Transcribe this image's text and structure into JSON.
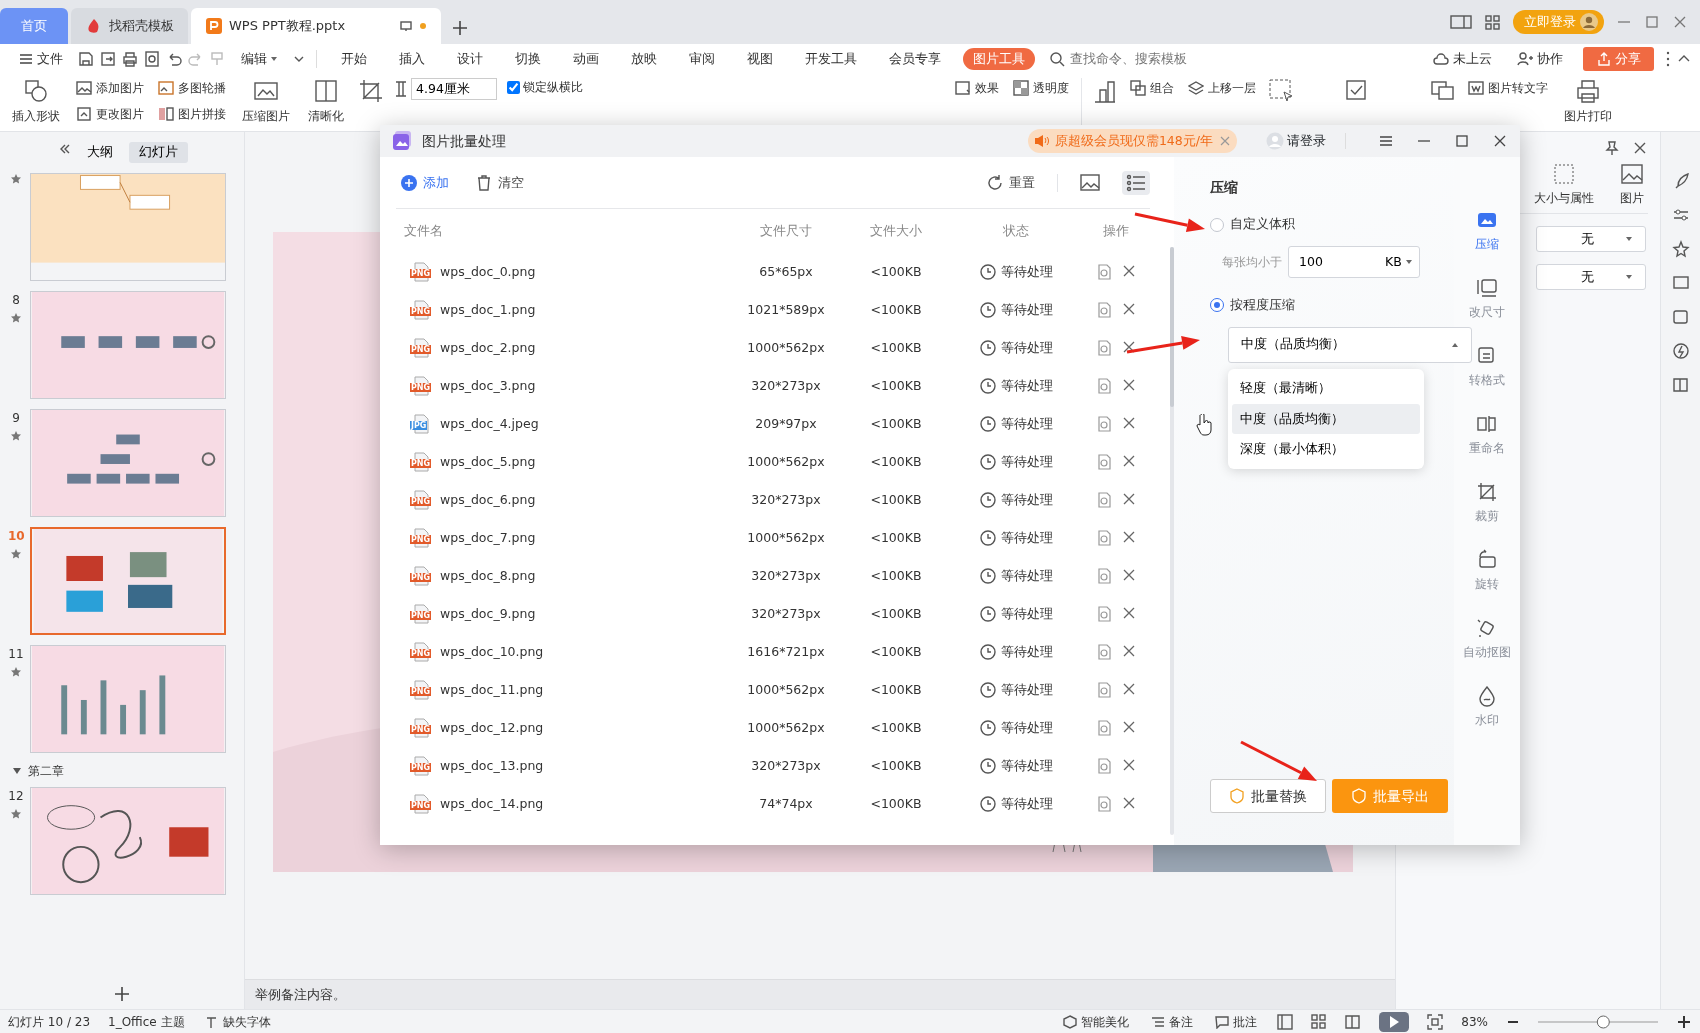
{
  "tabs": [
    {
      "label": "首页",
      "selected": false,
      "kind": "home"
    },
    {
      "label": "找稻壳模板",
      "selected": false,
      "kind": "docer"
    },
    {
      "label": "WPS PPT教程.pptx",
      "selected": true,
      "kind": "doc"
    }
  ],
  "title_bar": {
    "login": "立即登录"
  },
  "menu": {
    "file": "文件",
    "edit": "编辑",
    "items": [
      {
        "label": "开始",
        "selected": false
      },
      {
        "label": "插入",
        "selected": false
      },
      {
        "label": "设计",
        "selected": false
      },
      {
        "label": "切换",
        "selected": false
      },
      {
        "label": "动画",
        "selected": false
      },
      {
        "label": "放映",
        "selected": false
      },
      {
        "label": "审阅",
        "selected": false
      },
      {
        "label": "视图",
        "selected": false
      },
      {
        "label": "开发工具",
        "selected": false
      },
      {
        "label": "会员专享",
        "selected": false
      },
      {
        "label": "图片工具",
        "selected": true
      }
    ],
    "search_placeholder": "查找命令、搜索模板",
    "cloud": "未上云",
    "collab": "协作",
    "share": "分享"
  },
  "ribbon": {
    "insert_shape": "插入形状",
    "add_picture": "添加图片",
    "change_picture": "更改图片",
    "carousel": "多图轮播",
    "collage": "图片拼接",
    "compress": "压缩图片",
    "sharpen": "清晰化",
    "width": "4.94厘米",
    "lock_ratio": {
      "label": "锁定纵横比",
      "checked": true
    },
    "effects": "效果",
    "transparency": "透明度",
    "group": "组合",
    "bring_forward": "上移一层",
    "pic_to_text": "图片转文字",
    "print": "图片打印"
  },
  "left_panel": {
    "tabs": [
      {
        "label": "大纲",
        "selected": false
      },
      {
        "label": "幻灯片",
        "selected": true
      }
    ],
    "slides": [
      {
        "selected": false,
        "kind": "mindmap"
      },
      {
        "number": "8",
        "selected": false,
        "kind": "flow"
      },
      {
        "number": "9",
        "selected": false,
        "kind": "org"
      },
      {
        "number": "10",
        "selected": true,
        "kind": "icons"
      },
      {
        "number": "11",
        "selected": false,
        "kind": "chart"
      },
      {
        "number": "12",
        "selected": false,
        "kind": "doodle",
        "section": "第二章"
      }
    ]
  },
  "notes": "举例备注内容。",
  "right_panel": {
    "tabs": [
      {
        "label": "大小与属性",
        "selected": false
      },
      {
        "label": "图片",
        "selected": false
      }
    ],
    "selects": [
      "无",
      "无"
    ]
  },
  "dialog": {
    "title": "图片批量处理",
    "promo": "原超级会员现仅需148元/年",
    "login": "请登录",
    "toolbar": {
      "add": "添加",
      "clear": "清空",
      "reset": "重置",
      "views": [
        {
          "kind": "grid",
          "selected": false
        },
        {
          "kind": "list",
          "selected": true
        }
      ]
    },
    "columns": [
      "文件名",
      "文件尺寸",
      "文件大小",
      "状态",
      "操作"
    ],
    "rows": [
      {
        "name": "wps_doc_0.png",
        "kind": "png",
        "badge": "PNG",
        "dims": "65*65px",
        "size": "<100KB",
        "status": "等待处理"
      },
      {
        "name": "wps_doc_1.png",
        "kind": "png",
        "badge": "PNG",
        "dims": "1021*589px",
        "size": "<100KB",
        "status": "等待处理"
      },
      {
        "name": "wps_doc_2.png",
        "kind": "png",
        "badge": "PNG",
        "dims": "1000*562px",
        "size": "<100KB",
        "status": "等待处理"
      },
      {
        "name": "wps_doc_3.png",
        "kind": "png",
        "badge": "PNG",
        "dims": "320*273px",
        "size": "<100KB",
        "status": "等待处理"
      },
      {
        "name": "wps_doc_4.jpeg",
        "kind": "jpg",
        "badge": "JPG",
        "dims": "209*97px",
        "size": "<100KB",
        "status": "等待处理"
      },
      {
        "name": "wps_doc_5.png",
        "kind": "png",
        "badge": "PNG",
        "dims": "1000*562px",
        "size": "<100KB",
        "status": "等待处理"
      },
      {
        "name": "wps_doc_6.png",
        "kind": "png",
        "badge": "PNG",
        "dims": "320*273px",
        "size": "<100KB",
        "status": "等待处理"
      },
      {
        "name": "wps_doc_7.png",
        "kind": "png",
        "badge": "PNG",
        "dims": "1000*562px",
        "size": "<100KB",
        "status": "等待处理"
      },
      {
        "name": "wps_doc_8.png",
        "kind": "png",
        "badge": "PNG",
        "dims": "320*273px",
        "size": "<100KB",
        "status": "等待处理"
      },
      {
        "name": "wps_doc_9.png",
        "kind": "png",
        "badge": "PNG",
        "dims": "320*273px",
        "size": "<100KB",
        "status": "等待处理"
      },
      {
        "name": "wps_doc_10.png",
        "kind": "png",
        "badge": "PNG",
        "dims": "1616*721px",
        "size": "<100KB",
        "status": "等待处理"
      },
      {
        "name": "wps_doc_11.png",
        "kind": "png",
        "badge": "PNG",
        "dims": "1000*562px",
        "size": "<100KB",
        "status": "等待处理"
      },
      {
        "name": "wps_doc_12.png",
        "kind": "png",
        "badge": "PNG",
        "dims": "1000*562px",
        "size": "<100KB",
        "status": "等待处理"
      },
      {
        "name": "wps_doc_13.png",
        "kind": "png",
        "badge": "PNG",
        "dims": "320*273px",
        "size": "<100KB",
        "status": "等待处理"
      },
      {
        "name": "wps_doc_14.png",
        "kind": "png",
        "badge": "PNG",
        "dims": "74*74px",
        "size": "<100KB",
        "status": "等待处理"
      }
    ],
    "settings": {
      "heading": "压缩",
      "modes": [
        {
          "label": "自定义体积",
          "selected": false
        },
        {
          "label": "按程度压缩",
          "selected": true
        }
      ],
      "size_label": "每张均小于",
      "size_value": "100",
      "unit": "KB",
      "level_value": "中度（品质均衡）",
      "expanded": true,
      "levels": [
        {
          "label": "轻度（最清晰）",
          "selected": false
        },
        {
          "label": "中度（品质均衡）",
          "selected": true
        },
        {
          "label": "深度（最小体积）",
          "selected": false
        }
      ]
    },
    "nav": [
      {
        "label": "压缩",
        "selected": true,
        "kind": "compress"
      },
      {
        "label": "改尺寸",
        "selected": false,
        "kind": "resize"
      },
      {
        "label": "转格式",
        "selected": false,
        "kind": "format"
      },
      {
        "label": "重命名",
        "selected": false,
        "kind": "rename"
      },
      {
        "label": "裁剪",
        "selected": false,
        "kind": "crop"
      },
      {
        "label": "旋转",
        "selected": false,
        "kind": "rotate"
      },
      {
        "label": "自动抠图",
        "selected": false,
        "kind": "cutout"
      },
      {
        "label": "水印",
        "selected": false,
        "kind": "watermark"
      }
    ],
    "buttons": {
      "replace": "批量替换",
      "export": "批量导出"
    }
  },
  "status_bar": {
    "slide": "幻灯片 10 / 23",
    "theme": "1_Office 主题",
    "fonts": "缺失字体",
    "beautify": "智能美化",
    "notes": "备注",
    "comments": "批注",
    "zoom": "83%",
    "zoom_slider": {
      "level": 0.55
    }
  }
}
